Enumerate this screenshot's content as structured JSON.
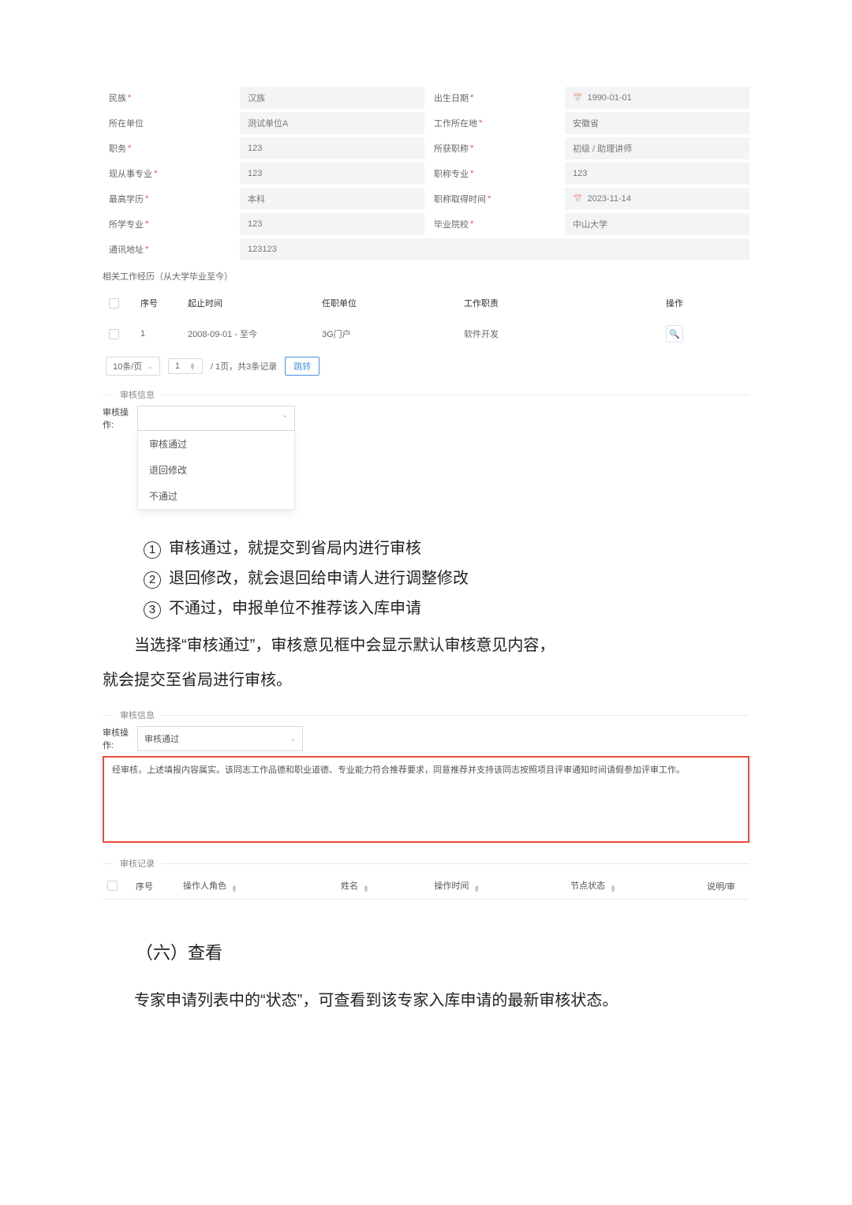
{
  "form": {
    "ethnicity_label": "民族",
    "ethnicity_value": "汉族",
    "birth_label": "出生日期",
    "birth_value": "1990-01-01",
    "unit_label": "所在单位",
    "unit_value": "测试单位A",
    "workplace_label": "工作所在地",
    "workplace_value": "安徽省",
    "duty_label": "职务",
    "duty_value": "123",
    "title_got_label": "所获职称",
    "title_got_value": "初级 / 助理讲师",
    "major_now_label": "现从事专业",
    "major_now_value": "123",
    "title_major_label": "职称专业",
    "title_major_value": "123",
    "edu_label": "最高学历",
    "edu_value": "本科",
    "title_date_label": "职称取得时间",
    "title_date_value": "2023-11-14",
    "study_major_label": "所学专业",
    "study_major_value": "123",
    "grad_school_label": "毕业院校",
    "grad_school_value": "中山大学",
    "addr_label": "通讯地址",
    "addr_value": "123123"
  },
  "work_history": {
    "title": "相关工作经历（从大学毕业至今）",
    "headers": {
      "idx": "序号",
      "period": "起止时间",
      "unit": "任职单位",
      "job": "工作职责",
      "op": "操作"
    },
    "row": {
      "idx": "1",
      "period": "2008-09-01 - 至今",
      "unit": "3G门户",
      "job": "软件开发"
    }
  },
  "pager": {
    "size": "10条/页",
    "page": "1",
    "info": "/ 1页，共3条记录",
    "jump": "跳转"
  },
  "audit1": {
    "section": "审核信息",
    "label": "审核操作:",
    "opt1": "审核通过",
    "opt2": "退回修改",
    "opt3": "不通过"
  },
  "notes": {
    "n1": "审核通过，就提交到省局内进行审核",
    "n2": "退回修改，就会退回给申请人进行调整修改",
    "n3": "不通过，申报单位不推荐该入库申请",
    "p1": "当选择“审核通过”，审核意见框中会显示默认审核意见内容，",
    "p2": "就会提交至省局进行审核。"
  },
  "audit2": {
    "section": "审核信息",
    "label": "审核操作:",
    "selected": "审核通过",
    "opinion": "经审核，上述填报内容属实。该同志工作品德和职业道德、专业能力符合推荐要求，同意推荐并支持该同志按照项目评审通知时间请假参加评审工作。"
  },
  "log": {
    "section": "审核记录",
    "headers": {
      "idx": "序号",
      "role": "操作人角色",
      "name": "姓名",
      "time": "操作时间",
      "status": "节点状态",
      "remark": "说明/审"
    }
  },
  "section6": {
    "heading": "（六）查看",
    "p": "专家申请列表中的“状态”，可查看到该专家入库申请的最新审核状态。"
  }
}
